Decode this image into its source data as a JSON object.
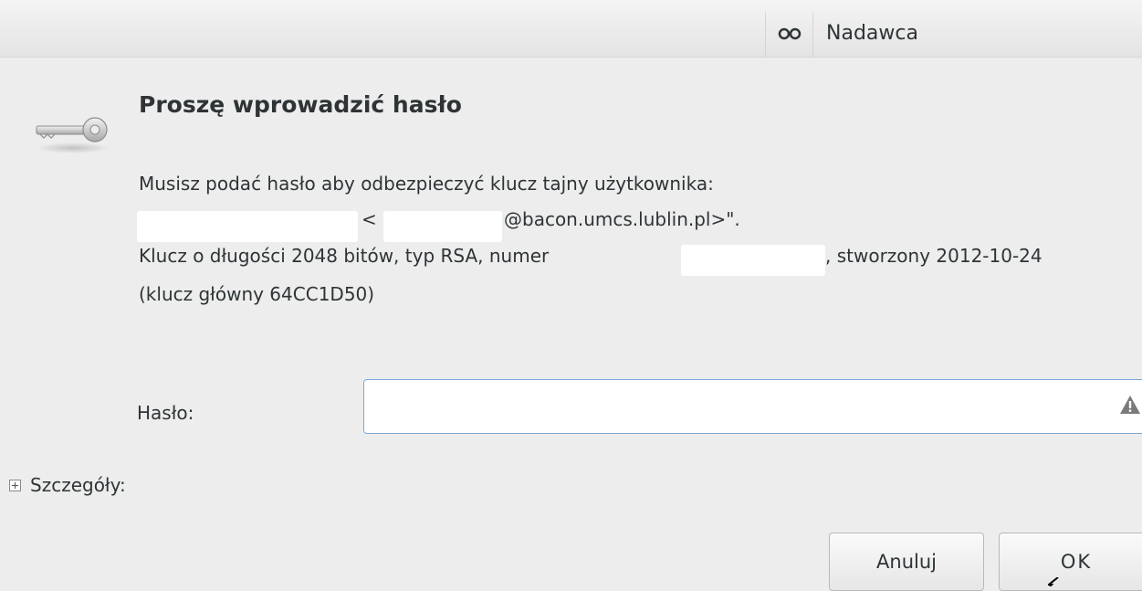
{
  "header": {
    "icon": "glasses-icon",
    "sender_label": "Nadawca"
  },
  "dialog": {
    "icon": "key-icon",
    "title": "Proszę wprowadzić hasło",
    "message": {
      "line1": "Musisz podać hasło aby odbezpieczyć klucz tajny użytkownika:",
      "line2_left": "<",
      "line2_right": "@bacon.umcs.lublin.pl>\".",
      "line3_left": "Klucz o długości 2048 bitów, typ RSA, numer",
      "line3_right": ", stworzony 2012-10-24",
      "line4": "(klucz główny 64CC1D50)"
    },
    "password": {
      "label": "Hasło:",
      "value": "",
      "placeholder": "",
      "warning_icon": "warning-icon"
    },
    "details": {
      "label": "Szczegóły:",
      "expanded": false
    },
    "buttons": {
      "cancel": "Anuluj",
      "ok": "OK"
    }
  },
  "colors": {
    "background": "#ededed",
    "text": "#2e3436",
    "input_border_focus": "#7ea7d6"
  }
}
